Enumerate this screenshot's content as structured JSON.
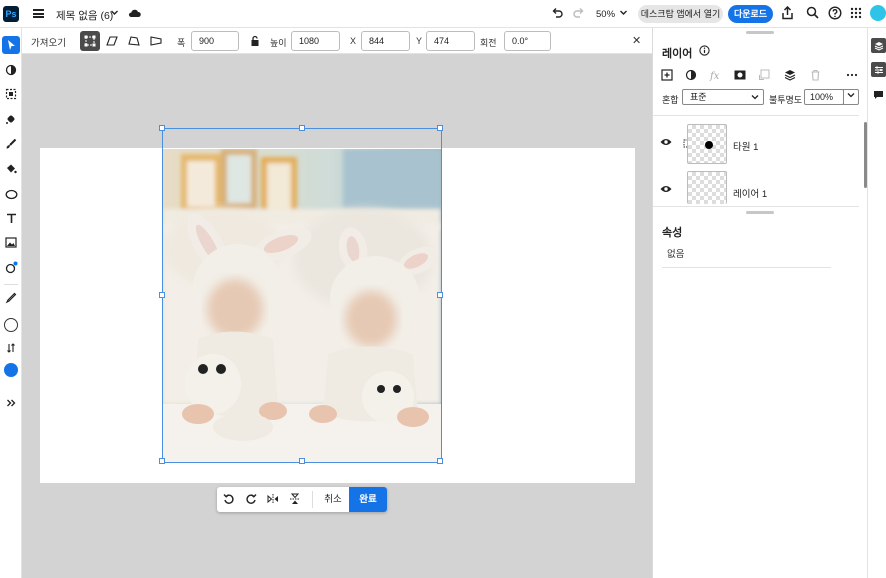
{
  "app": {
    "logo": "Ps",
    "doc_title": "제목 없음 (6)",
    "zoom": "50%"
  },
  "topbar": {
    "open_desktop_label": "데스크탑 앱에서 열기",
    "download_label": "다운로드"
  },
  "options": {
    "mode_label": "가져오기",
    "width_label": "폭",
    "width_value": "900",
    "height_label": "높이",
    "height_value": "1080",
    "x_label": "X",
    "x_value": "844",
    "y_label": "Y",
    "y_value": "474",
    "rotate_label": "회전",
    "rotate_value": "0.0°",
    "close_symbol": "✕"
  },
  "transform_bar": {
    "cancel_label": "취소",
    "done_label": "완료"
  },
  "layers_panel": {
    "title": "레이어",
    "blend_label": "혼합",
    "blend_value": "표준",
    "opacity_label": "불투명도",
    "opacity_value": "100%",
    "layers": [
      {
        "name": "타원 1"
      },
      {
        "name": "레이어 1"
      }
    ]
  },
  "properties_panel": {
    "title": "속성",
    "value": "없음"
  },
  "colors": {
    "accent": "#1473e6",
    "foreground": "#1473e6",
    "bbox": "#4a8fe0"
  }
}
